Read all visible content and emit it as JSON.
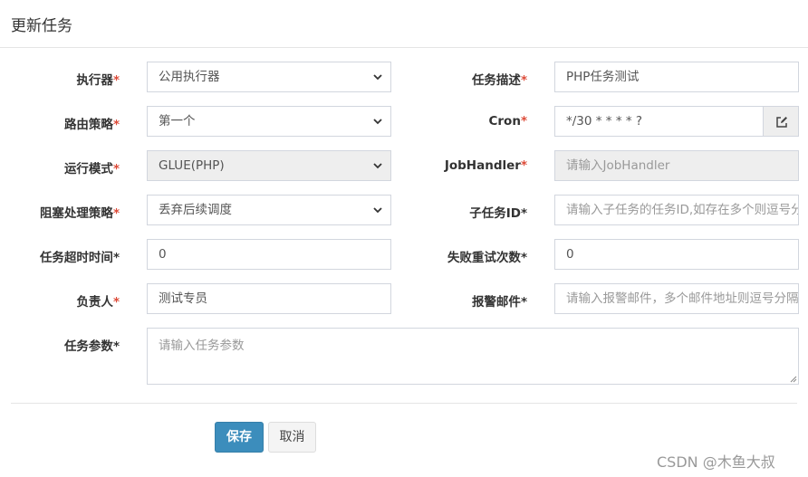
{
  "header": {
    "title": "更新任务"
  },
  "form": {
    "executor": {
      "label": "执行器",
      "value": "公用执行器"
    },
    "job_desc": {
      "label": "任务描述",
      "value": "PHP任务测试"
    },
    "route_strategy": {
      "label": "路由策略",
      "value": "第一个"
    },
    "cron": {
      "label": "Cron",
      "value": "*/30 * * * * ?"
    },
    "glue_type": {
      "label": "运行模式",
      "value": "GLUE(PHP)"
    },
    "job_handler": {
      "label": "JobHandler",
      "placeholder": "请输入JobHandler"
    },
    "block_strategy": {
      "label": "阻塞处理策略",
      "value": "丢弃后续调度"
    },
    "child_job_id": {
      "label": "子任务ID",
      "placeholder": "请输入子任务的任务ID,如存在多个则逗号分隔"
    },
    "timeout": {
      "label": "任务超时时间",
      "value": "0"
    },
    "fail_retry": {
      "label": "失败重试次数",
      "value": "0"
    },
    "author": {
      "label": "负责人",
      "value": "测试专员"
    },
    "alarm_email": {
      "label": "报警邮件",
      "placeholder": "请输入报警邮件，多个邮件地址则逗号分隔"
    },
    "executor_param": {
      "label": "任务参数",
      "placeholder": "请输入任务参数"
    }
  },
  "footer": {
    "save_label": "保存",
    "cancel_label": "取消"
  },
  "watermark": "CSDN @木鱼大叔",
  "colors": {
    "primary": "#3c8dbc",
    "required": "#dd4b39",
    "disabled_bg": "#eeeeee",
    "border": "#d2d6de"
  },
  "icons": {
    "cron_addon": "edit-icon",
    "select_arrow": "chevron-down-icon"
  }
}
